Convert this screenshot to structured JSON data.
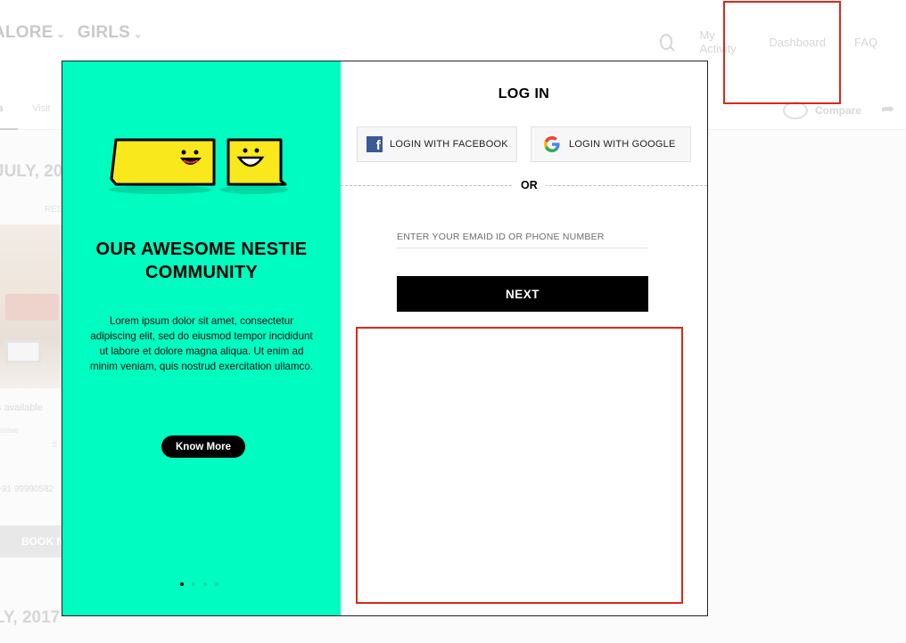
{
  "background": {
    "nav_left": [
      "ALORE",
      "GIRLS"
    ],
    "nav_right": [
      "My Activity",
      "Dashboard",
      "FAQ"
    ],
    "tab_active": "ts",
    "tab_visit": "Visit",
    "compare": "Compare",
    "date_top": "JULY, 20",
    "res_label": "RES",
    "availability": "s available",
    "small_text": "ssive",
    "small_text_2": "S",
    "phone": "+91 99990582",
    "book_button": "BOOK N",
    "date_bottom": "LY, 2017"
  },
  "modal": {
    "promo": {
      "title": "OUR AWESOME NESTIE COMMUNITY",
      "body": "Lorem ipsum dolor sit amet, consectetur adipiscing elit, sed do eiusmod tempor incididunt ut labore et dolore magna aliqua. Ut enim ad minim veniam, quis nostrud exercitation ullamco.",
      "cta": "Know More",
      "slides": 4,
      "active_slide": 1
    },
    "login": {
      "title": "LOG IN",
      "facebook_label": "LOGIN WITH FACEBOOK",
      "google_label": "LOGIN WITH GOOGLE",
      "or_label": "OR",
      "email_placeholder": "ENTER YOUR EMAID ID OR PHONE NUMBER",
      "email_value": "",
      "next_label": "NEXT"
    }
  },
  "colors": {
    "promo_bg": "#00fcc0",
    "mascot_yellow": "#f9e81b",
    "highlight_red": "#d9291c",
    "facebook_blue": "#3b5998"
  },
  "icons": [
    "search-icon",
    "chevron-down-icon",
    "compare-icon",
    "share-icon",
    "facebook-icon",
    "google-icon",
    "mascot-illustration"
  ]
}
